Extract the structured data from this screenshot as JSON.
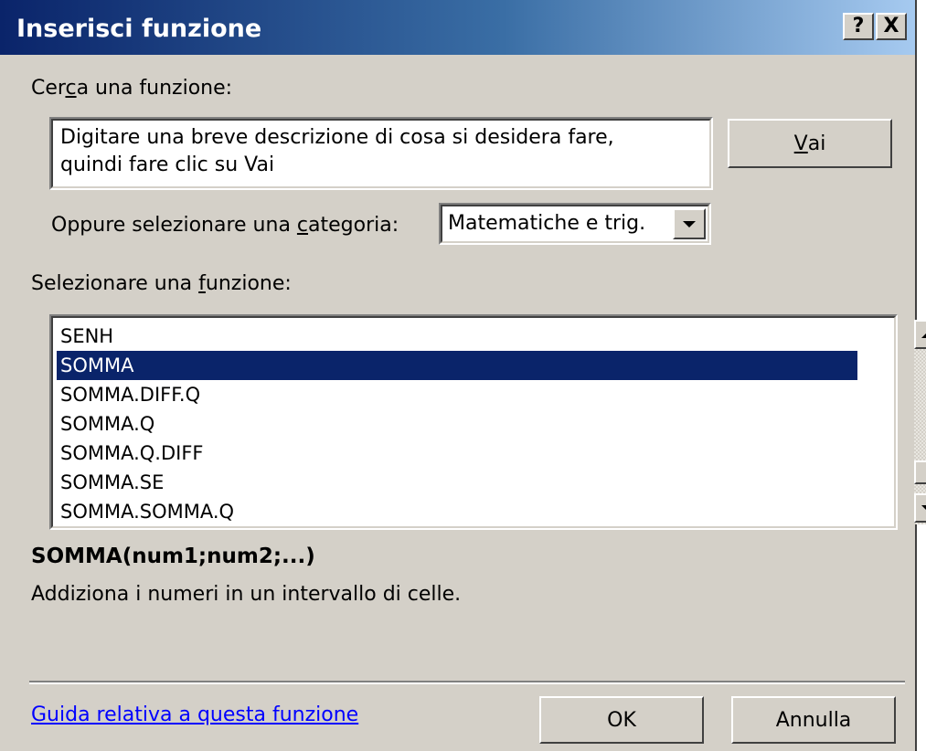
{
  "window": {
    "title": "Inserisci funzione",
    "help_button": "?",
    "close_button": "X"
  },
  "search": {
    "label_before": "Cer",
    "label_accel": "c",
    "label_after": "a una funzione:",
    "value_line1": "Digitare una breve descrizione di cosa si desidera fare,",
    "value_line2": "quindi fare clic su Vai",
    "go_button_accel": "V",
    "go_button_rest": "ai"
  },
  "category": {
    "label_before": "Oppure selezionare una ",
    "label_accel": "c",
    "label_after": "ategoria:",
    "selected": "Matematiche e trig."
  },
  "function_list": {
    "label_before": "Selezionare una ",
    "label_accel": "f",
    "label_after": "unzione:",
    "items": [
      "SENH",
      "SOMMA",
      "SOMMA.DIFF.Q",
      "SOMMA.Q",
      "SOMMA.Q.DIFF",
      "SOMMA.SE",
      "SOMMA.SOMMA.Q"
    ],
    "selected_index": 1
  },
  "details": {
    "signature": "SOMMA(num1;num2;...)",
    "description": "Addiziona i numeri in un intervallo di celle."
  },
  "footer": {
    "help_link": "Guida relativa a questa funzione",
    "ok_label": "OK",
    "cancel_label": "Annulla"
  },
  "colors": {
    "dialog_bg": "#d4d0c8",
    "title_bar_start": "#0a246a",
    "selection_bg": "#0a246a",
    "link": "#0000ff"
  }
}
